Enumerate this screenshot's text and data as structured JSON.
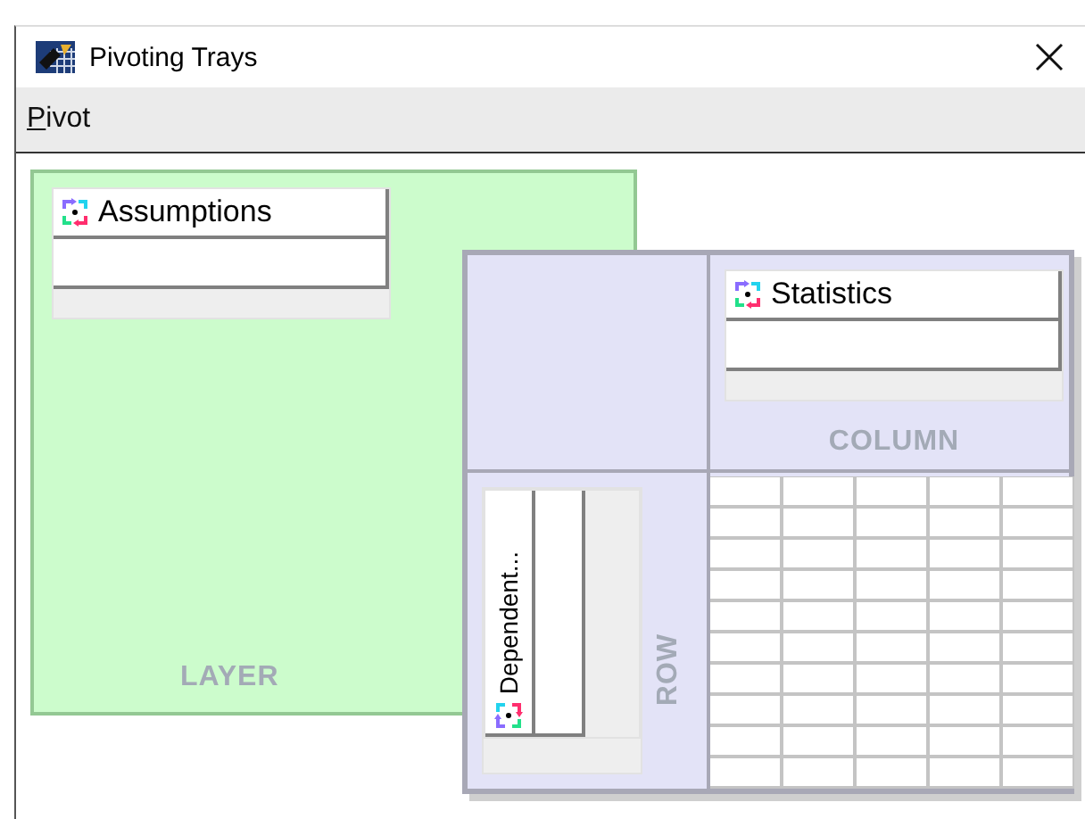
{
  "window": {
    "title": "Pivoting Trays"
  },
  "menu": [
    {
      "label": "Pivot",
      "mnemonic_underlined": true
    }
  ],
  "layer_tray": {
    "label": "LAYER",
    "items": [
      {
        "label": "Assumptions"
      }
    ]
  },
  "column_tray": {
    "label": "COLUMN",
    "items": [
      {
        "label": "Statistics"
      }
    ]
  },
  "row_tray": {
    "label": "ROW",
    "items": [
      {
        "label": "Dependent..."
      }
    ]
  }
}
